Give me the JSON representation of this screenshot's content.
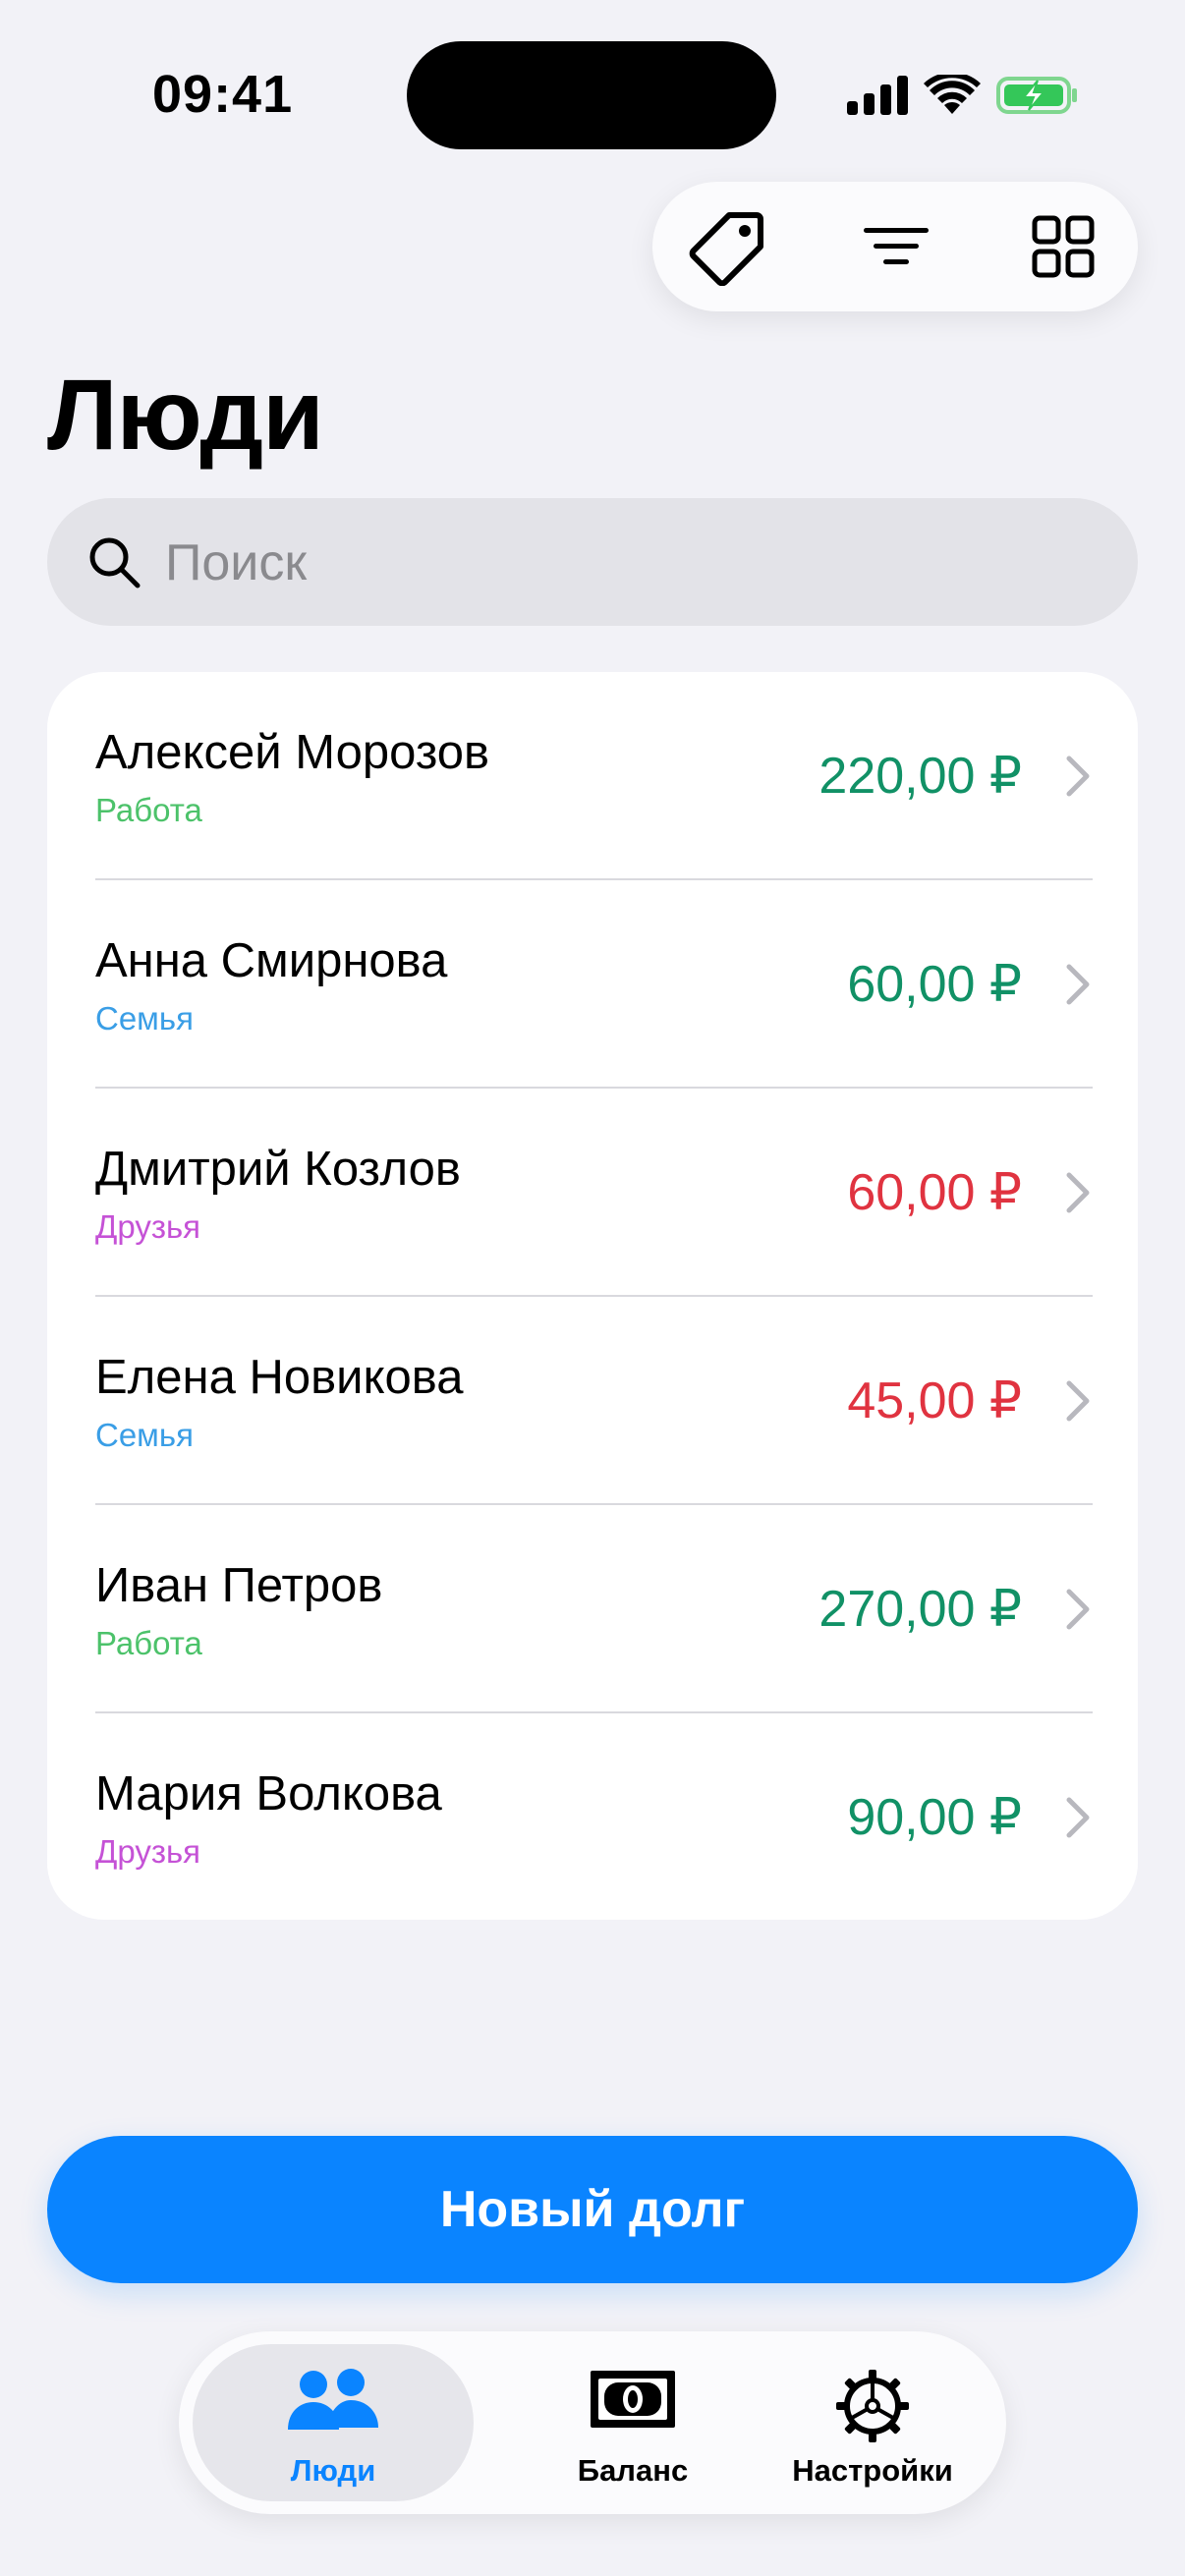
{
  "status_bar": {
    "time": "09:41",
    "icons": [
      "cellular-signal-icon",
      "wifi-icon",
      "battery-charging-icon"
    ]
  },
  "toolbar": {
    "buttons": [
      {
        "icon": "tag-icon"
      },
      {
        "icon": "filter-lines-icon"
      },
      {
        "icon": "grid-icon"
      }
    ]
  },
  "page": {
    "title": "Люди"
  },
  "search": {
    "placeholder": "Поиск",
    "value": ""
  },
  "people": [
    {
      "name": "Алексей Морозов",
      "group": "Работа",
      "amount": "220,00 ₽",
      "status": "positive"
    },
    {
      "name": "Анна Смирнова",
      "group": "Семья",
      "amount": "60,00 ₽",
      "status": "positive"
    },
    {
      "name": "Дмитрий Козлов",
      "group": "Друзья",
      "amount": "60,00 ₽",
      "status": "negative"
    },
    {
      "name": "Елена Новикова",
      "group": "Семья",
      "amount": "45,00 ₽",
      "status": "negative"
    },
    {
      "name": "Иван Петров",
      "group": "Работа",
      "amount": "270,00 ₽",
      "status": "positive"
    },
    {
      "name": "Мария Волкова",
      "group": "Друзья",
      "amount": "90,00 ₽",
      "status": "positive"
    }
  ],
  "group_colors": {
    "Работа": "#4CC26A",
    "Семья": "#3A9EE6",
    "Друзья": "#C552D6"
  },
  "amount_colors": {
    "positive": "#119166",
    "negative": "#E03340"
  },
  "actions": {
    "new_debt_label": "Новый долг"
  },
  "tabbar": {
    "tabs": [
      {
        "label": "Люди",
        "icon": "people-icon",
        "active": true
      },
      {
        "label": "Баланс",
        "icon": "banknote-icon",
        "active": false
      },
      {
        "label": "Настройки",
        "icon": "gear-icon",
        "active": false
      }
    ]
  },
  "colors": {
    "accent": "#0A84FF",
    "background": "#F2F2F7"
  }
}
